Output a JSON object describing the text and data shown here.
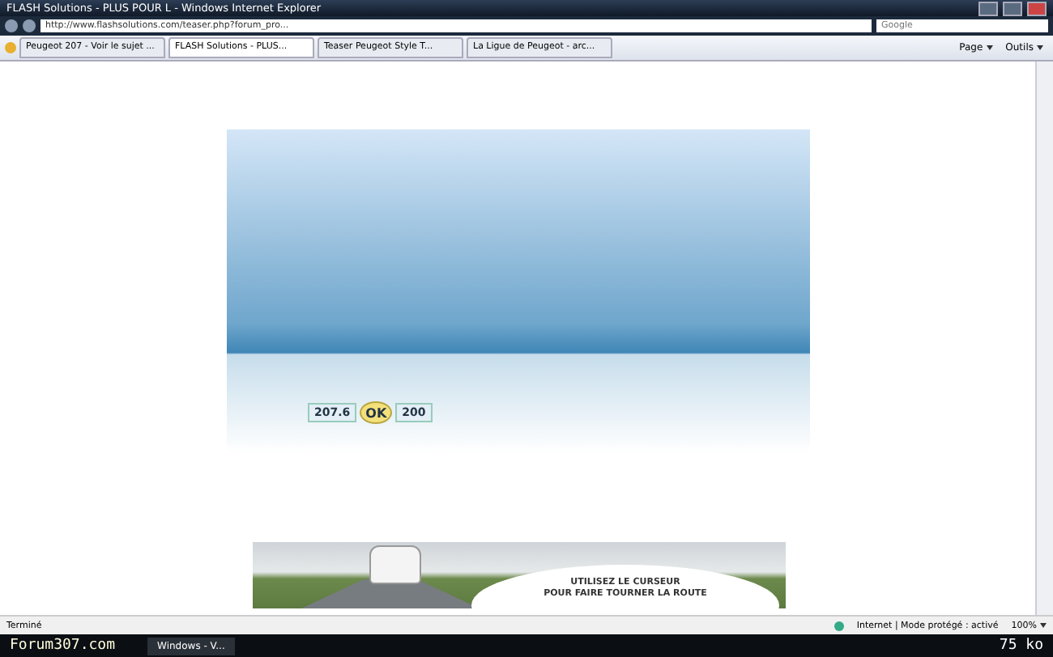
{
  "window": {
    "title": "FLASH Solutions - PLUS POUR L - Windows Internet Explorer"
  },
  "address_bar": {
    "url": "http://www.flashsolutions.com/teaser.php?forum_pro...",
    "search_placeholder": "Google"
  },
  "tabs": [
    {
      "label": "Peugeot 207 - Voir le sujet ...",
      "selected": false
    },
    {
      "label": "FLASH Solutions - PLUS...",
      "selected": true
    },
    {
      "label": "Teaser Peugeot Style T...",
      "selected": false
    },
    {
      "label": "La Ligue de Peugeot - arc...",
      "selected": false
    }
  ],
  "toolbar": {
    "buttons": [
      "Page",
      "Outils"
    ]
  },
  "flash": {
    "left_value": "207.6",
    "button": "OK",
    "right_value": "200"
  },
  "banner": {
    "lines": [
      "UTILISEZ LE CURSEUR",
      "POUR FAIRE TOURNER LA ROUTE"
    ]
  },
  "status_bar": {
    "text": "Terminé",
    "zone": "Internet | Mode protégé : activé",
    "zoom": "100%"
  },
  "taskbar": {
    "site": "Forum307.com",
    "task": "Windows - V...",
    "size": "75 ko"
  }
}
